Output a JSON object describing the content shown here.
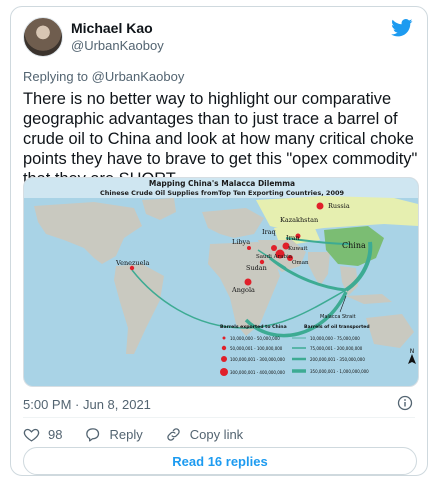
{
  "tweet": {
    "author_name": "Michael Kao",
    "author_handle": "@UrbanKaoboy",
    "reply_prefix": "Replying to ",
    "reply_handle": "@UrbanKaoboy",
    "text": "There is no better way to highlight our comparative geographic advantages than to just trace a barrel of crude oil to China and look at how many critical choke points they have to brave to get this \"opex commodity\" that they are SHORT.",
    "timestamp": "5:00 PM · Jun 8, 2021",
    "likes": "98",
    "reply_label": "Reply",
    "copy_link_label": "Copy link",
    "read_replies_label": "Read 16 replies",
    "icons": [
      "twitter-bird-icon",
      "info-icon",
      "heart-icon",
      "reply-icon",
      "link-icon"
    ],
    "accent_color": "#1d9bf0"
  },
  "map": {
    "title": "Mapping China's Malacca Dilemma",
    "subtitle": "Chinese Crude Oil Supplies fromTop Ten Exporting Countries, 2009",
    "labels": [
      "Venezuela",
      "Libya",
      "Iraq",
      "Iran",
      "Kuwait",
      "Saudi Arabia",
      "Oman",
      "Sudan",
      "Angola",
      "Kazakhstan",
      "Russia",
      "China",
      "Malacca Strait",
      "N"
    ],
    "legend": {
      "exports_title": "Barrels exported to China",
      "exports": [
        "10,000,000 - 50,000,000",
        "50,000,001 - 100,000,000",
        "100,000,001 - 300,000,000",
        "300,000,001 - 400,000,000"
      ],
      "transport_title": "Barrels of oil transported",
      "transport": [
        "10,000,000 - 75,000,000",
        "75,000,001 - 200,000,000",
        "200,000,001 - 350,000,000",
        "350,000,001 - 1,000,000,000"
      ]
    }
  }
}
